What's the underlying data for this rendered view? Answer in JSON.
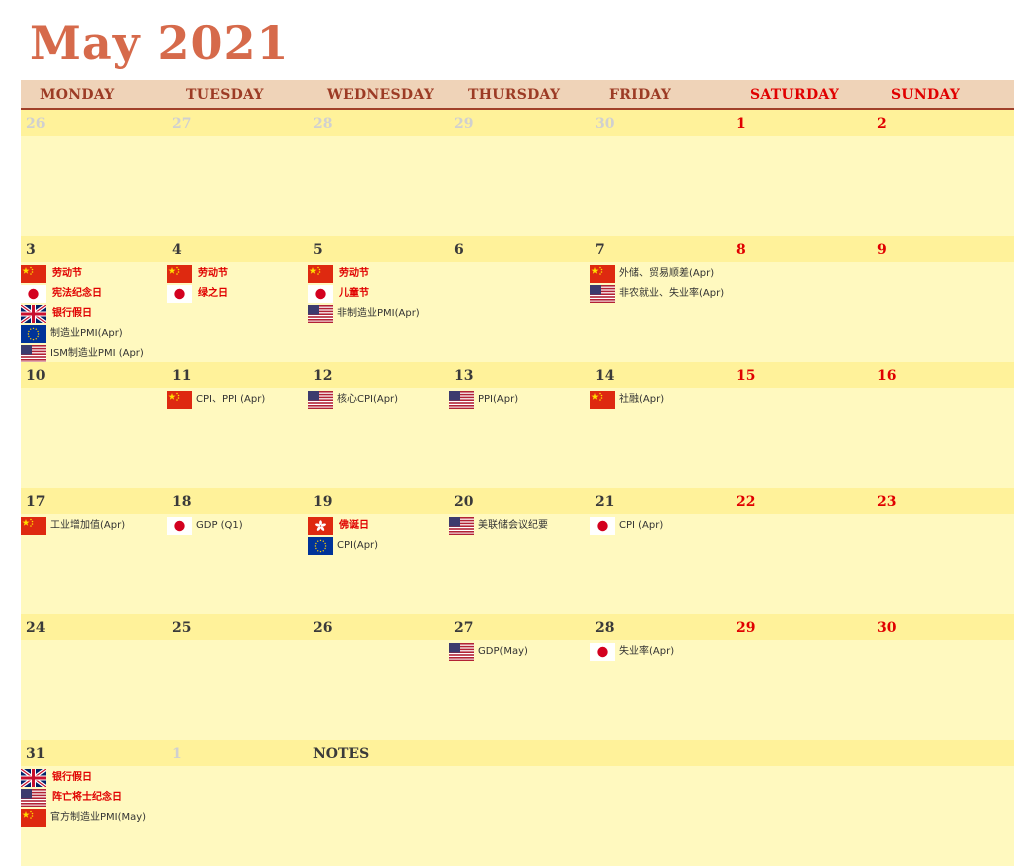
{
  "title": "May 2021",
  "weekdays": [
    {
      "label": "MONDAY",
      "weekend": false
    },
    {
      "label": "TUESDAY",
      "weekend": false
    },
    {
      "label": "WEDNESDAY",
      "weekend": false
    },
    {
      "label": "THURSDAY",
      "weekend": false
    },
    {
      "label": "FRIDAY",
      "weekend": false
    },
    {
      "label": "SATURDAY",
      "weekend": true
    },
    {
      "label": "SUNDAY",
      "weekend": true
    }
  ],
  "notes_label": "NOTES",
  "weeks": [
    {
      "days": [
        {
          "num": "26",
          "style": "grey",
          "events": []
        },
        {
          "num": "27",
          "style": "grey",
          "events": []
        },
        {
          "num": "28",
          "style": "grey",
          "events": []
        },
        {
          "num": "29",
          "style": "grey",
          "events": []
        },
        {
          "num": "30",
          "style": "grey",
          "events": []
        },
        {
          "num": "1",
          "style": "red",
          "events": []
        },
        {
          "num": "2",
          "style": "red",
          "events": []
        }
      ]
    },
    {
      "days": [
        {
          "num": "3",
          "style": "normal",
          "events": [
            {
              "flag": "cn",
              "text": "劳动节",
              "red": true
            },
            {
              "flag": "jp",
              "text": "宪法纪念日",
              "red": true
            },
            {
              "flag": "uk",
              "text": "银行假日",
              "red": true
            },
            {
              "flag": "eu",
              "text": "制造业PMI(Apr)",
              "red": false
            },
            {
              "flag": "us",
              "text": "ISM制造业PMI (Apr)",
              "red": false
            }
          ]
        },
        {
          "num": "4",
          "style": "normal",
          "events": [
            {
              "flag": "cn",
              "text": "劳动节",
              "red": true
            },
            {
              "flag": "jp",
              "text": "绿之日",
              "red": true
            }
          ]
        },
        {
          "num": "5",
          "style": "normal",
          "events": [
            {
              "flag": "cn",
              "text": "劳动节",
              "red": true
            },
            {
              "flag": "jp",
              "text": "儿童节",
              "red": true
            },
            {
              "flag": "us",
              "text": "非制造业PMI(Apr)",
              "red": false
            }
          ]
        },
        {
          "num": "6",
          "style": "normal",
          "events": []
        },
        {
          "num": "7",
          "style": "normal",
          "events": [
            {
              "flag": "cn",
              "text": "外储、贸易顺差(Apr)",
              "red": false
            },
            {
              "flag": "us",
              "text": "非农就业、失业率(Apr)",
              "red": false
            }
          ]
        },
        {
          "num": "8",
          "style": "red",
          "events": []
        },
        {
          "num": "9",
          "style": "red",
          "events": []
        }
      ]
    },
    {
      "days": [
        {
          "num": "10",
          "style": "normal",
          "events": []
        },
        {
          "num": "11",
          "style": "normal",
          "events": [
            {
              "flag": "cn",
              "text": "CPI、PPI (Apr)",
              "red": false
            }
          ]
        },
        {
          "num": "12",
          "style": "normal",
          "events": [
            {
              "flag": "us",
              "text": "核心CPI(Apr)",
              "red": false
            }
          ]
        },
        {
          "num": "13",
          "style": "normal",
          "events": [
            {
              "flag": "us",
              "text": "PPI(Apr)",
              "red": false
            }
          ]
        },
        {
          "num": "14",
          "style": "normal",
          "events": [
            {
              "flag": "cn",
              "text": "社融(Apr)",
              "red": false
            }
          ]
        },
        {
          "num": "15",
          "style": "red",
          "events": []
        },
        {
          "num": "16",
          "style": "red",
          "events": []
        }
      ]
    },
    {
      "days": [
        {
          "num": "17",
          "style": "normal",
          "events": [
            {
              "flag": "cn",
              "text": "工业增加值(Apr)",
              "red": false
            }
          ]
        },
        {
          "num": "18",
          "style": "normal",
          "events": [
            {
              "flag": "jp",
              "text": "GDP (Q1)",
              "red": false
            }
          ]
        },
        {
          "num": "19",
          "style": "normal",
          "events": [
            {
              "flag": "hk",
              "text": "佛诞日",
              "red": true
            },
            {
              "flag": "eu",
              "text": "CPI(Apr)",
              "red": false
            }
          ]
        },
        {
          "num": "20",
          "style": "normal",
          "events": [
            {
              "flag": "us",
              "text": "美联储会议纪要",
              "red": false
            }
          ]
        },
        {
          "num": "21",
          "style": "normal",
          "events": [
            {
              "flag": "jp",
              "text": "CPI (Apr)",
              "red": false
            }
          ]
        },
        {
          "num": "22",
          "style": "red",
          "events": []
        },
        {
          "num": "23",
          "style": "red",
          "events": []
        }
      ]
    },
    {
      "days": [
        {
          "num": "24",
          "style": "normal",
          "events": []
        },
        {
          "num": "25",
          "style": "normal",
          "events": []
        },
        {
          "num": "26",
          "style": "normal",
          "events": []
        },
        {
          "num": "27",
          "style": "normal",
          "events": [
            {
              "flag": "us",
              "text": "GDP(May)",
              "red": false
            }
          ]
        },
        {
          "num": "28",
          "style": "normal",
          "events": [
            {
              "flag": "jp",
              "text": "失业率(Apr)",
              "red": false
            }
          ]
        },
        {
          "num": "29",
          "style": "red",
          "events": []
        },
        {
          "num": "30",
          "style": "red",
          "events": []
        }
      ]
    },
    {
      "days": [
        {
          "num": "31",
          "style": "normal",
          "events": [
            {
              "flag": "uk",
              "text": "银行假日",
              "red": true
            },
            {
              "flag": "us",
              "text": "阵亡将士纪念日",
              "red": true
            },
            {
              "flag": "cn",
              "text": "官方制造业PMI(May)",
              "red": false
            }
          ]
        },
        {
          "num": "1",
          "style": "grey",
          "events": []
        }
      ]
    }
  ],
  "colors": {
    "title": "#d66a4b",
    "header_bg": "#efd3b8",
    "header_text": "#9c3b25",
    "weekend_text": "#e00000",
    "date_strip": "#fff29a",
    "cell_bg": "#fff9bf"
  }
}
